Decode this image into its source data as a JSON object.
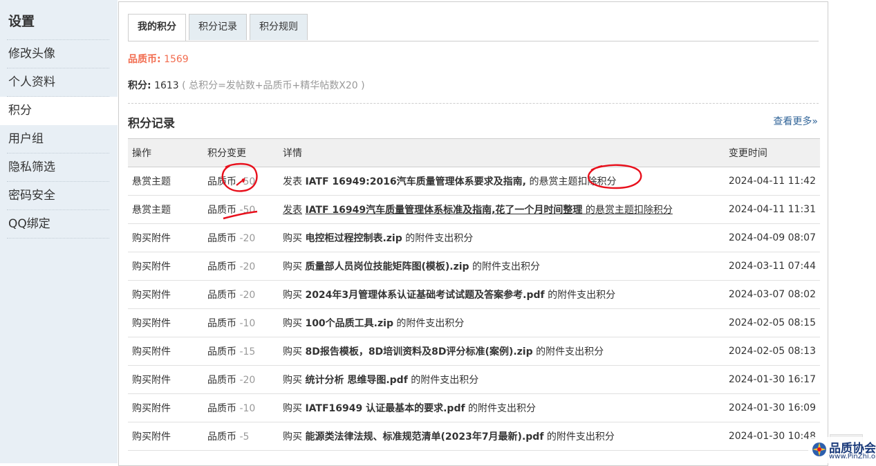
{
  "sidebar": {
    "title": "设置",
    "items": [
      {
        "label": "修改头像"
      },
      {
        "label": "个人资料"
      },
      {
        "label": "积分"
      },
      {
        "label": "用户组"
      },
      {
        "label": "隐私筛选"
      },
      {
        "label": "密码安全"
      },
      {
        "label": "QQ绑定"
      }
    ],
    "active_index": 2
  },
  "tabs": [
    {
      "label": "我的积分"
    },
    {
      "label": "积分记录"
    },
    {
      "label": "积分规则"
    }
  ],
  "summary": {
    "coin_label": "品质币:",
    "coin_value": "1569",
    "credit_label": "积分:",
    "credit_value": "1613",
    "credit_formula": "( 总积分=发帖数+品质币+精华帖数X20 )"
  },
  "records": {
    "title": "积分记录",
    "more": "查看更多»",
    "headers": {
      "op": "操作",
      "change": "积分变更",
      "detail": "详情",
      "time": "变更时间"
    },
    "rows": [
      {
        "op": "悬赏主题",
        "currency": "品质币",
        "amount": "-50",
        "verb": "发表",
        "target": "IATF 16949:2016汽车质量管理体系要求及指南,",
        "suffix": " 的悬赏主题扣除积分",
        "time": "2024-04-11 11:42"
      },
      {
        "op": "悬赏主题",
        "currency": "品质币",
        "amount": "-50",
        "verb": "发表",
        "target": "IATF 16949汽车质量管理体系标准及指南,花了一个月时间整理",
        "suffix": " 的悬赏主题扣除积分",
        "time": "2024-04-11 11:31"
      },
      {
        "op": "购买附件",
        "currency": "品质币",
        "amount": "-20",
        "verb": "购买",
        "target": "电控柜过程控制表.zip",
        "suffix": " 的附件支出积分",
        "time": "2024-04-09 08:07"
      },
      {
        "op": "购买附件",
        "currency": "品质币",
        "amount": "-20",
        "verb": "购买",
        "target": "质量部人员岗位技能矩阵图(模板).zip",
        "suffix": " 的附件支出积分",
        "time": "2024-03-11 07:44"
      },
      {
        "op": "购买附件",
        "currency": "品质币",
        "amount": "-20",
        "verb": "购买",
        "target": "2024年3月管理体系认证基础考试试题及答案参考.pdf",
        "suffix": " 的附件支出积分",
        "time": "2024-03-07 08:02"
      },
      {
        "op": "购买附件",
        "currency": "品质币",
        "amount": "-10",
        "verb": "购买",
        "target": "100个品质工具.zip",
        "suffix": " 的附件支出积分",
        "time": "2024-02-05 08:15"
      },
      {
        "op": "购买附件",
        "currency": "品质币",
        "amount": "-15",
        "verb": "购买",
        "target": "8D报告模板，8D培训资料及8D评分标准(案例).zip",
        "suffix": " 的附件支出积分",
        "time": "2024-02-05 08:13"
      },
      {
        "op": "购买附件",
        "currency": "品质币",
        "amount": "-20",
        "verb": "购买",
        "target": "统计分析 思维导图.pdf",
        "suffix": " 的附件支出积分",
        "time": "2024-01-30 16:17"
      },
      {
        "op": "购买附件",
        "currency": "品质币",
        "amount": "-10",
        "verb": "购买",
        "target": "IATF16949 认证最基本的要求.pdf",
        "suffix": " 的附件支出积分",
        "time": "2024-01-30 16:09"
      },
      {
        "op": "购买附件",
        "currency": "品质币",
        "amount": "-5",
        "verb": "购买",
        "target": "能源类法律法规、标准规范清单(2023年7月最新).pdf",
        "suffix": " 的附件支出积分",
        "time": "2024-01-30 10:48"
      }
    ]
  },
  "watermark": {
    "cn": "品质协会",
    "en": "www.PinZhi.org"
  },
  "colors": {
    "sidebar_bg": "#e8eff5",
    "coin": "#f26c4f",
    "link": "#336699",
    "annotation": "#e8101c"
  }
}
